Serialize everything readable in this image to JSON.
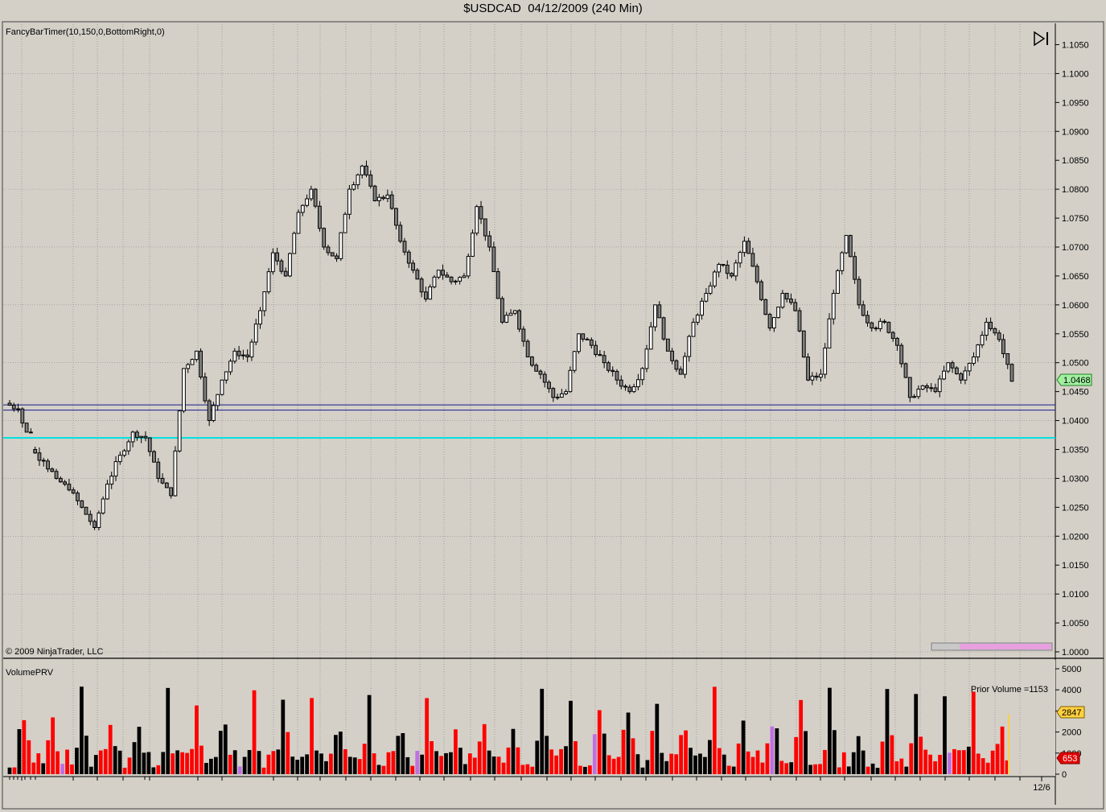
{
  "window": {
    "title": "$USDCAD  04/12/2009 (240 Min)"
  },
  "indicators": {
    "price_label": "FancyBarTimer(10,150,0,BottomRight,0)",
    "copyright": "© 2009 NinjaTrader, LLC",
    "volume_label": "VolumePRV",
    "prior_volume": "Prior Volume =1153"
  },
  "colors": {
    "background": "#d4d0c8",
    "grid": "#8c8c8c",
    "bar_up": "#ffffff",
    "bar_down": "#808080",
    "hline_blue": "#1a1a8c",
    "hline_cyan": "#00e0e0",
    "vol_up": "#000000",
    "vol_down": "#ff0000",
    "vol_neutral": "#c070e0",
    "last_price_bg": "#a0f0a0",
    "prior_vol_bg": "#ffd040",
    "current_vol_bg": "#e00000"
  },
  "chart_data": [
    {
      "type": "candlestick",
      "title": "$USDCAD  04/12/2009 (240 Min)",
      "y_ticks": [
        "1.1050",
        "1.1000",
        "1.0950",
        "1.0900",
        "1.0850",
        "1.0800",
        "1.0750",
        "1.0700",
        "1.0650",
        "1.0600",
        "1.0550",
        "1.0500",
        "1.0450",
        "1.0400",
        "1.0350",
        "1.0300",
        "1.0250",
        "1.0200",
        "1.0150",
        "1.0100",
        "1.0050",
        "1.0000"
      ],
      "ylim": [
        1.0,
        1.108
      ],
      "last_price": "1.0468",
      "horizontal_lines": [
        {
          "value": 1.0427,
          "color": "#1a1a8c"
        },
        {
          "value": 1.0418,
          "color": "#1a1a8c"
        },
        {
          "value": 1.037,
          "color": "#00e0e0"
        }
      ],
      "x_label": "12/6",
      "ohlc_anchors": [
        [
          1.043,
          1.0455,
          1.041,
          1.042
        ],
        [
          1.042,
          1.0435,
          1.038,
          1.035
        ],
        [
          1.035,
          1.037,
          1.032,
          1.033
        ],
        [
          1.033,
          1.035,
          1.028,
          1.03
        ],
        [
          1.03,
          1.032,
          1.026,
          1.028
        ],
        [
          1.028,
          1.03,
          1.023,
          1.025
        ],
        [
          1.025,
          1.026,
          1.0205,
          1.0215
        ],
        [
          1.0215,
          1.03,
          1.021,
          1.029
        ],
        [
          1.029,
          1.036,
          1.028,
          1.034
        ],
        [
          1.034,
          1.04,
          1.032,
          1.038
        ],
        [
          1.038,
          1.042,
          1.035,
          1.037
        ],
        [
          1.037,
          1.039,
          1.028,
          1.03
        ],
        [
          1.03,
          1.032,
          1.0265,
          1.027
        ],
        [
          1.027,
          1.05,
          1.0265,
          1.049
        ],
        [
          1.049,
          1.058,
          1.048,
          1.052
        ],
        [
          1.052,
          1.053,
          1.038,
          1.04
        ],
        [
          1.04,
          1.048,
          1.039,
          1.047
        ],
        [
          1.047,
          1.053,
          1.046,
          1.052
        ],
        [
          1.052,
          1.054,
          1.048,
          1.051
        ],
        [
          1.051,
          1.06,
          1.05,
          1.059
        ],
        [
          1.059,
          1.071,
          1.058,
          1.069
        ],
        [
          1.069,
          1.07,
          1.063,
          1.065
        ],
        [
          1.065,
          1.078,
          1.064,
          1.076
        ],
        [
          1.076,
          1.082,
          1.074,
          1.08
        ],
        [
          1.08,
          1.081,
          1.068,
          1.07
        ],
        [
          1.07,
          1.072,
          1.066,
          1.068
        ],
        [
          1.068,
          1.082,
          1.067,
          1.08
        ],
        [
          1.08,
          1.087,
          1.078,
          1.084
        ],
        [
          1.084,
          1.085,
          1.075,
          1.078
        ],
        [
          1.078,
          1.081,
          1.074,
          1.079
        ],
        [
          1.079,
          1.085,
          1.069,
          1.071
        ],
        [
          1.071,
          1.072,
          1.064,
          1.066
        ],
        [
          1.066,
          1.068,
          1.06,
          1.061
        ],
        [
          1.061,
          1.068,
          1.06,
          1.066
        ],
        [
          1.066,
          1.068,
          1.061,
          1.064
        ],
        [
          1.064,
          1.066,
          1.062,
          1.065
        ],
        [
          1.065,
          1.078,
          1.064,
          1.077
        ],
        [
          1.077,
          1.078,
          1.068,
          1.07
        ],
        [
          1.07,
          1.071,
          1.056,
          1.057
        ],
        [
          1.057,
          1.061,
          1.055,
          1.059
        ],
        [
          1.059,
          1.06,
          1.05,
          1.051
        ],
        [
          1.051,
          1.052,
          1.046,
          1.048
        ],
        [
          1.048,
          1.049,
          1.043,
          1.044
        ],
        [
          1.044,
          1.046,
          1.042,
          1.045
        ],
        [
          1.045,
          1.056,
          1.044,
          1.055
        ],
        [
          1.055,
          1.057,
          1.051,
          1.053
        ],
        [
          1.053,
          1.055,
          1.048,
          1.05
        ],
        [
          1.05,
          1.052,
          1.046,
          1.047
        ],
        [
          1.047,
          1.049,
          1.043,
          1.045
        ],
        [
          1.045,
          1.05,
          1.044,
          1.049
        ],
        [
          1.049,
          1.062,
          1.048,
          1.06
        ],
        [
          1.06,
          1.061,
          1.051,
          1.052
        ],
        [
          1.052,
          1.053,
          1.046,
          1.048
        ],
        [
          1.048,
          1.058,
          1.047,
          1.057
        ],
        [
          1.057,
          1.064,
          1.056,
          1.062
        ],
        [
          1.062,
          1.069,
          1.061,
          1.067
        ],
        [
          1.067,
          1.068,
          1.063,
          1.065
        ],
        [
          1.065,
          1.073,
          1.064,
          1.071
        ],
        [
          1.071,
          1.072,
          1.062,
          1.064
        ],
        [
          1.064,
          1.065,
          1.055,
          1.056
        ],
        [
          1.056,
          1.064,
          1.055,
          1.062
        ],
        [
          1.062,
          1.063,
          1.057,
          1.059
        ],
        [
          1.059,
          1.06,
          1.046,
          1.047
        ],
        [
          1.047,
          1.049,
          1.045,
          1.048
        ],
        [
          1.048,
          1.064,
          1.047,
          1.062
        ],
        [
          1.062,
          1.075,
          1.061,
          1.072
        ],
        [
          1.072,
          1.073,
          1.058,
          1.06
        ],
        [
          1.06,
          1.061,
          1.054,
          1.056
        ],
        [
          1.056,
          1.059,
          1.053,
          1.057
        ],
        [
          1.057,
          1.058,
          1.052,
          1.053
        ],
        [
          1.053,
          1.054,
          1.042,
          1.044
        ],
        [
          1.044,
          1.048,
          1.04,
          1.046
        ],
        [
          1.046,
          1.047,
          1.043,
          1.045
        ],
        [
          1.045,
          1.052,
          1.044,
          1.05
        ],
        [
          1.05,
          1.051,
          1.046,
          1.047
        ],
        [
          1.047,
          1.053,
          1.046,
          1.051
        ],
        [
          1.051,
          1.058,
          1.05,
          1.057
        ],
        [
          1.057,
          1.058,
          1.052,
          1.054
        ],
        [
          1.054,
          1.055,
          1.046,
          1.0468
        ]
      ]
    },
    {
      "type": "bar",
      "title": "VolumePRV",
      "y_ticks": [
        "5000",
        "4000",
        "3000",
        "2000",
        "1000",
        "0"
      ],
      "ylim": [
        0,
        5200
      ],
      "prior_volume_badge": "2847",
      "current_volume_badge": "653",
      "seed": 11,
      "count": 209
    }
  ]
}
